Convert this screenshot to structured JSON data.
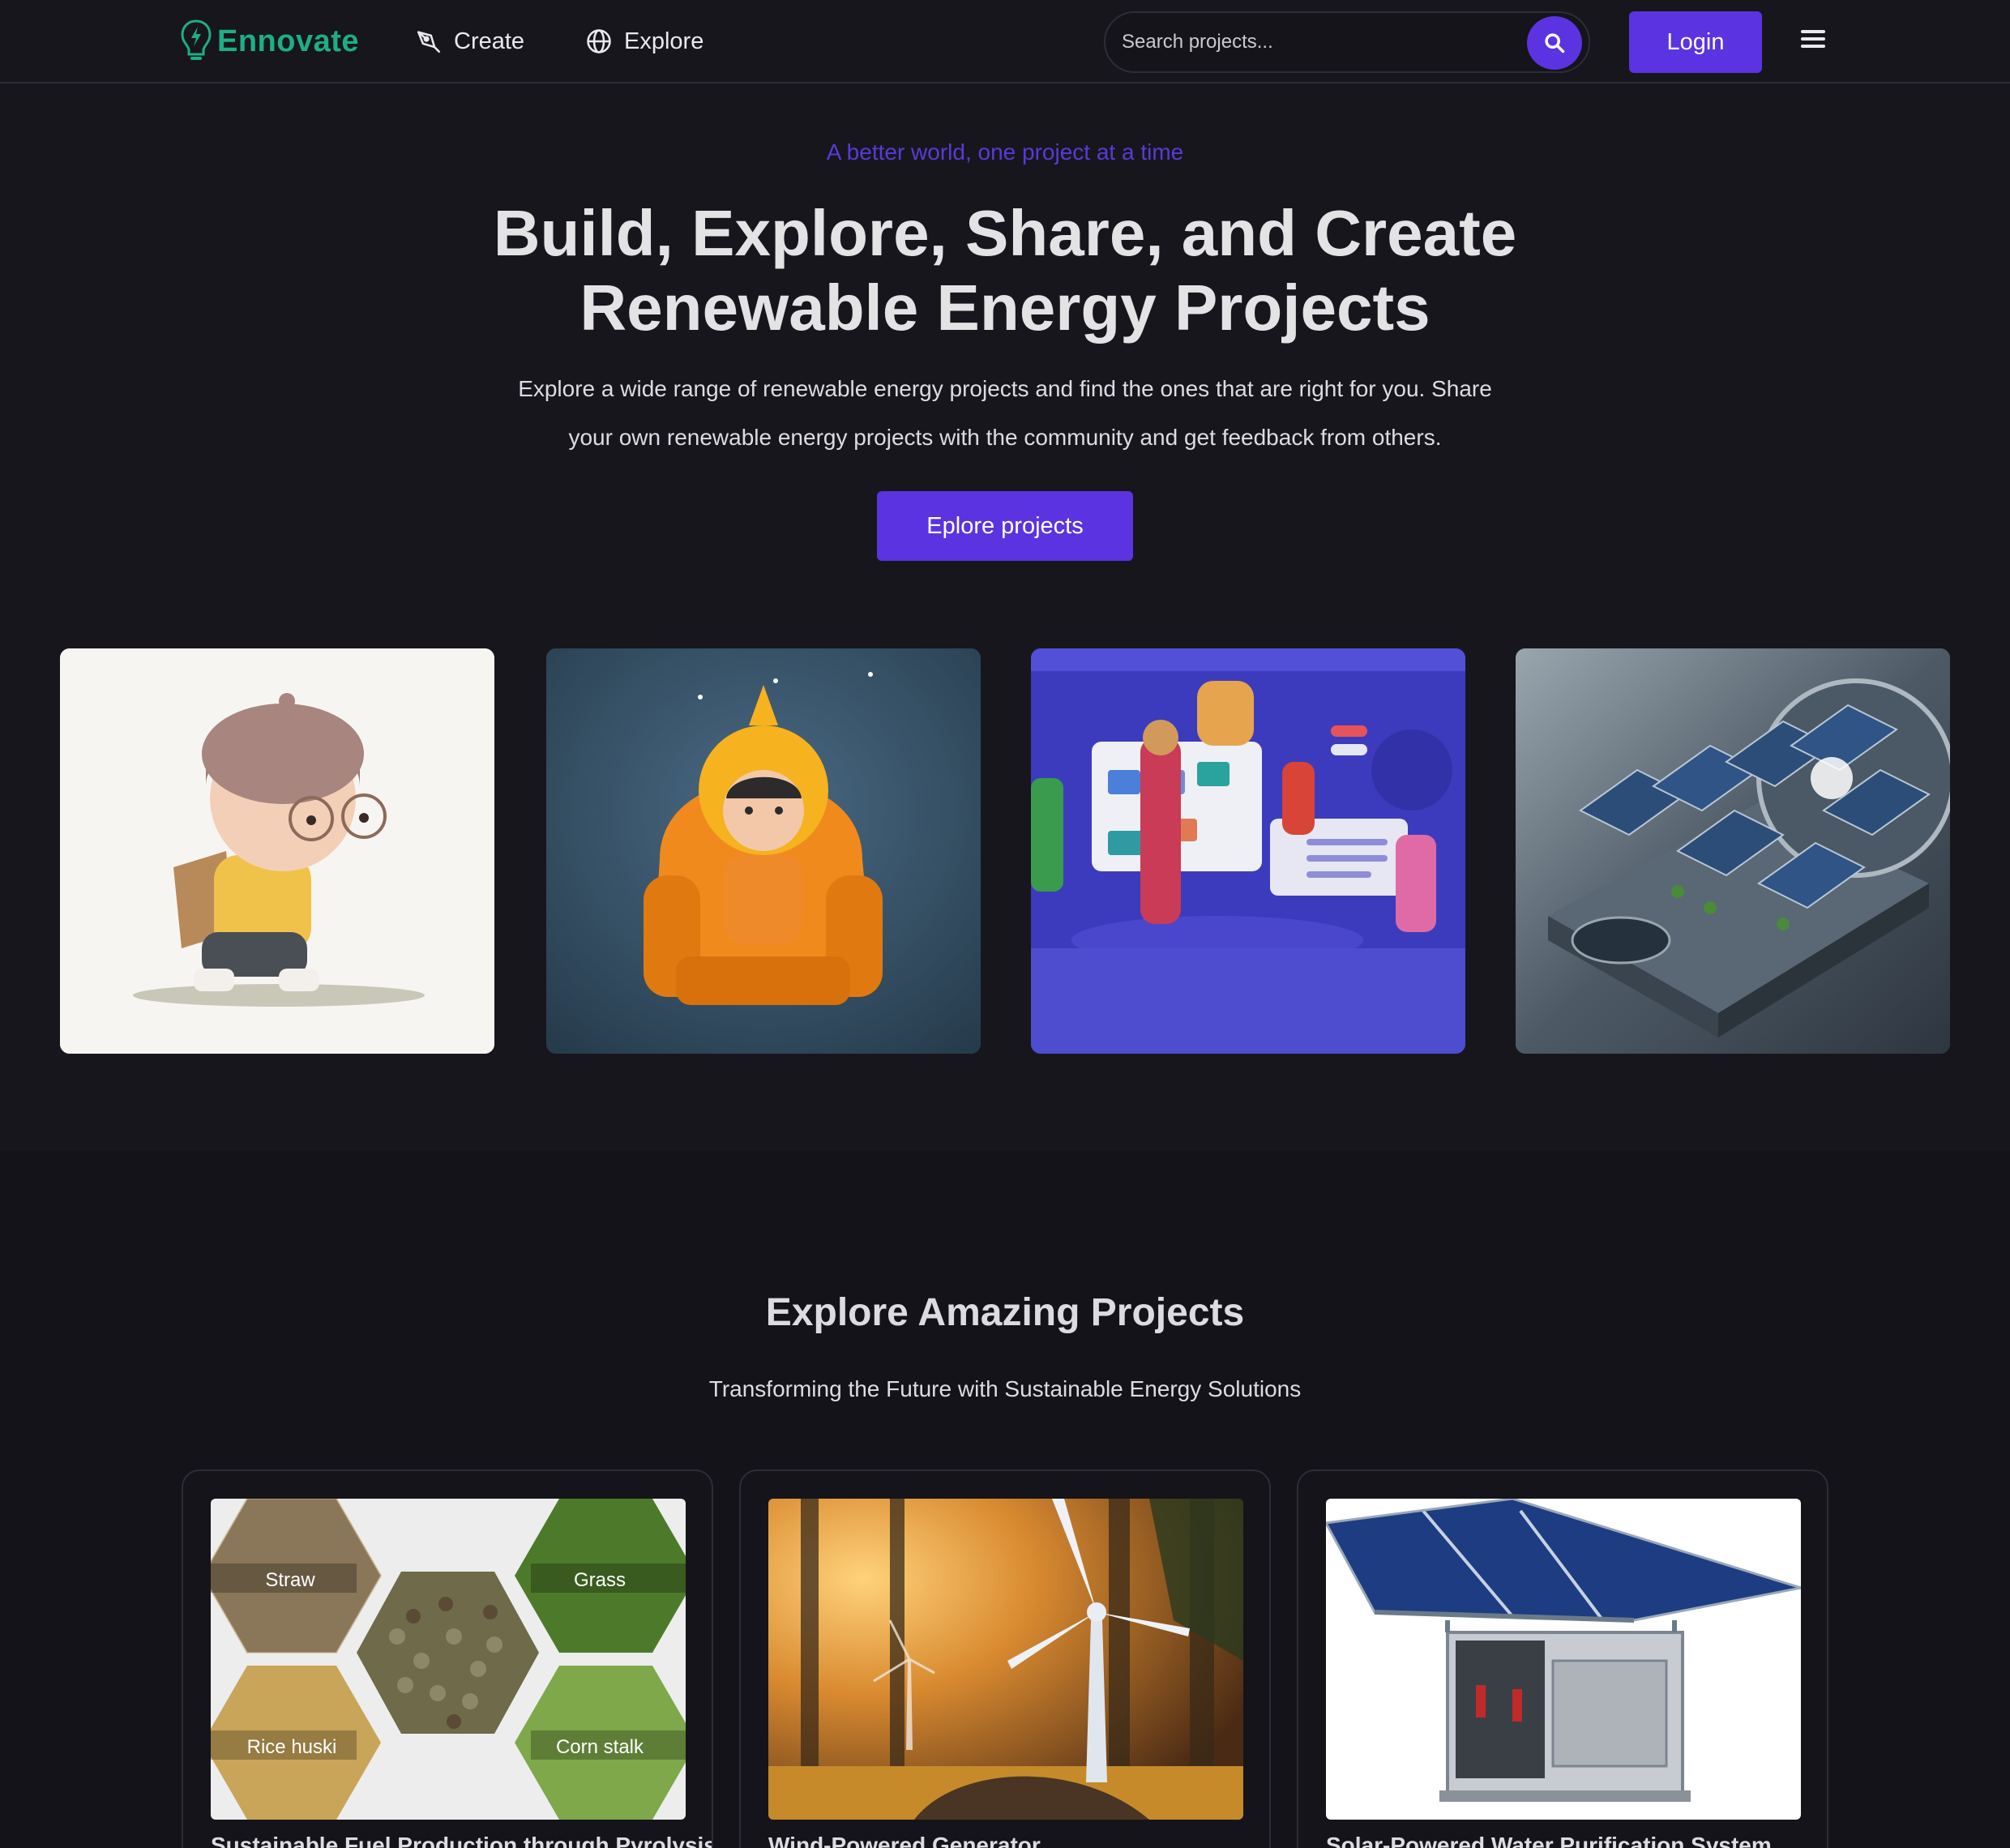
{
  "navbar": {
    "brand": "Ennovate",
    "links": [
      {
        "label": "Create",
        "icon": "pen-tool-icon"
      },
      {
        "label": "Explore",
        "icon": "globe-icon"
      }
    ],
    "search_placeholder": "Search projects...",
    "login_label": "Login",
    "menu_icon": "hamburger-menu-icon"
  },
  "hero": {
    "tagline": "A better world, one project at a time",
    "title_line1": "Build, Explore, Share, and Create",
    "title_line2": "Renewable Energy Projects",
    "subtitle_line1": "Explore a wide range of renewable energy projects and find the ones that are right for you. Share",
    "subtitle_line2": "your own renewable energy projects with the community and get feedback from others.",
    "cta_label": "Eplore projects"
  },
  "gallery": [
    {
      "icon": "kid-with-backpack-illustration"
    },
    {
      "icon": "kid-in-armchair-illustration"
    },
    {
      "icon": "team-collaboration-illustration"
    },
    {
      "icon": "solar-circuit-illustration"
    }
  ],
  "projects": {
    "title": "Explore Amazing Projects",
    "subtitle": "Transforming the Future with Sustainable Energy Solutions",
    "cards": [
      {
        "title": "Sustainable Fuel Production through Pyrolysis",
        "image_labels": [
          "Straw",
          "Grass",
          "Rice huski",
          "Corn stalk"
        ]
      },
      {
        "title": "Wind-Powered Generator"
      },
      {
        "title": "Solar-Powered Water Purification System"
      }
    ]
  },
  "colors": {
    "accent": "#5b33e0",
    "background": "#17161d",
    "brand_green": "#1fae84"
  }
}
